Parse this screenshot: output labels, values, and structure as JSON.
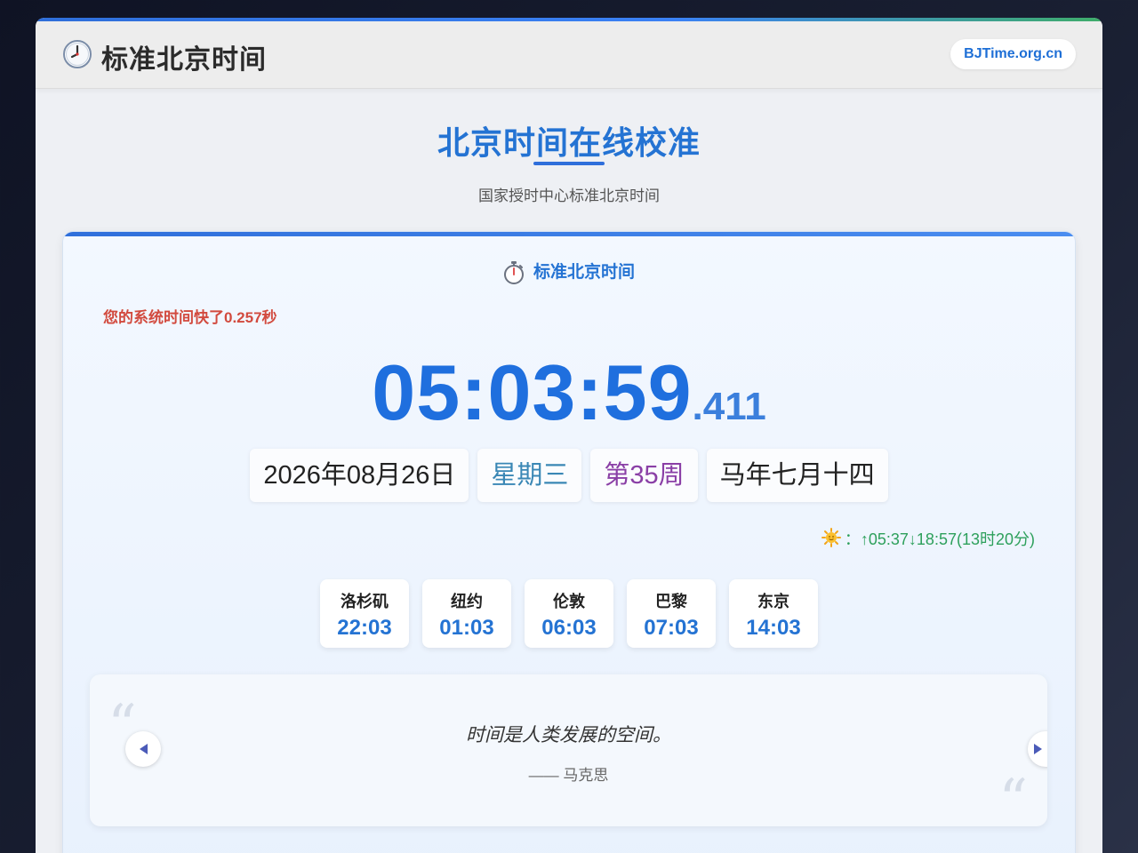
{
  "header": {
    "title": "标准北京时间",
    "icon": "clock-icon",
    "domain_badge": "BJTime.org.cn"
  },
  "hero": {
    "title": "北京时间在线校准",
    "subtitle": "国家授时中心标准北京时间"
  },
  "card": {
    "heading": "标准北京时间",
    "heading_icon": "stopwatch-icon",
    "offset_message": "您的系统时间快了0.257秒",
    "time": {
      "hms": "05:03:59",
      "ms": ".411"
    },
    "date": "2026年08月26日",
    "weekday": "星期三",
    "week": "第35周",
    "lunar": "马年七月十四",
    "sun": {
      "icon": "sun-icon",
      "text": "：↑05:37↓18:57(13时20分)"
    },
    "cities": [
      {
        "name": "洛杉矶",
        "time": "22:03"
      },
      {
        "name": "纽约",
        "time": "01:03"
      },
      {
        "name": "伦敦",
        "time": "06:03"
      },
      {
        "name": "巴黎",
        "time": "07:03"
      },
      {
        "name": "东京",
        "time": "14:03"
      }
    ],
    "quote": {
      "text": "时间是人类发展的空间。",
      "author": "—— 马克思",
      "open_mark": "“",
      "close_mark": "“"
    }
  },
  "colors": {
    "accent": "#2473d3",
    "offset_warning": "#d24a3e",
    "sun_text": "#2ea05c",
    "weekday": "#3a87b5",
    "week": "#8a3fa6"
  }
}
